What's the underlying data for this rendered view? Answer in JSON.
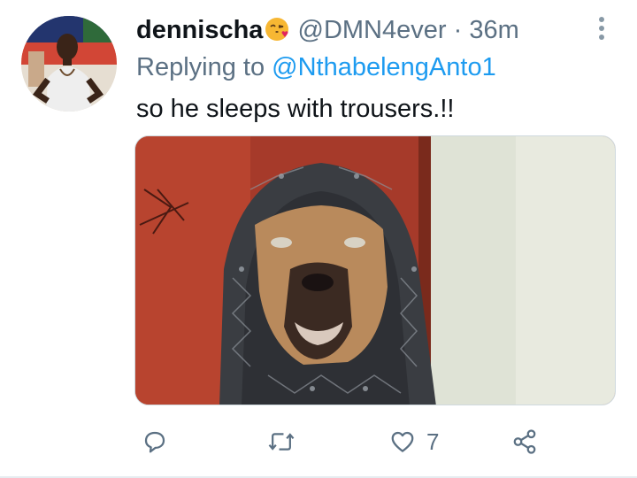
{
  "tweet": {
    "display_name": "dennischa",
    "name_emoji": "face-throwing-kiss-emoji",
    "handle": "@DMN4ever",
    "separator": "·",
    "time": "36m",
    "replying_prefix": "Replying to ",
    "replying_to": "@NthabelengAnto1",
    "text": "so he sleeps with trousers.!!",
    "media": {
      "description_icon": "photo-dog-in-hoodie"
    }
  },
  "actions": {
    "reply_icon": "reply-icon",
    "retweet_icon": "retweet-icon",
    "like_icon": "heart-icon",
    "like_count": "7",
    "share_icon": "share-icon"
  },
  "colors": {
    "primary_text": "#0f1419",
    "secondary_text": "#5b7083",
    "link": "#1d9bf0",
    "border": "#cfd9de"
  }
}
